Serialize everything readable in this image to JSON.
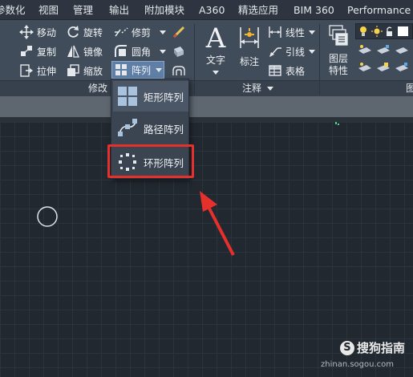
{
  "menu_tabs": [
    "参数化",
    "视图",
    "管理",
    "输出",
    "附加模块",
    "A360",
    "精选应用",
    "BIM 360",
    "Performance"
  ],
  "ribbon": {
    "modify": {
      "move": "移动",
      "rotate": "旋转",
      "trim": "修剪",
      "copy": "复制",
      "mirror": "镜像",
      "fillet": "圆角",
      "stretch": "拉伸",
      "scale": "缩放",
      "array": "阵列",
      "panel_label": "修改"
    },
    "annotation": {
      "text": "文字",
      "dimension": "标注",
      "linear": "线性",
      "leader": "引线",
      "table": "表格",
      "panel_label": "注释"
    },
    "layers": {
      "layer_properties": "图层\n特性",
      "cut_label": "图"
    }
  },
  "array_dropdown": {
    "items": [
      "矩形阵列",
      "路径阵列",
      "环形阵列"
    ]
  },
  "watermark": {
    "brand": "搜狗指南",
    "url": "zhinan.sogou.com"
  },
  "colors": {
    "highlight": "#e5302b",
    "arrow": "#e5302b",
    "canvas": "#212830"
  }
}
